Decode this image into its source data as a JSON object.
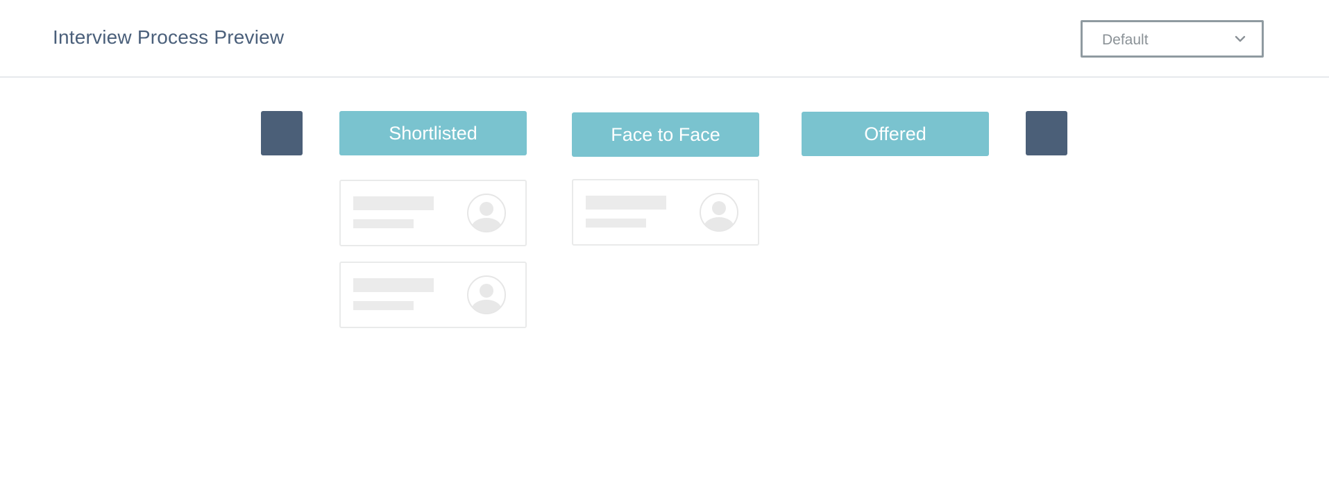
{
  "header": {
    "title": "Interview Process Preview",
    "dropdown": {
      "selected": "Default",
      "icon": "chevron-down-icon"
    }
  },
  "board": {
    "nav": {
      "left_icon": "nav-left-square",
      "right_icon": "nav-right-square"
    },
    "stages": [
      {
        "label": "Shortlisted",
        "placeholder_cards": 2
      },
      {
        "label": "Face to Face",
        "placeholder_cards": 1
      },
      {
        "label": "Offered",
        "placeholder_cards": 0
      }
    ]
  },
  "colors": {
    "title": "#4a5f7a",
    "stage_bg": "#7ac3cf",
    "nav_square": "#4b5f78",
    "placeholder": "#ebebeb",
    "card_border": "#e9eaea"
  }
}
